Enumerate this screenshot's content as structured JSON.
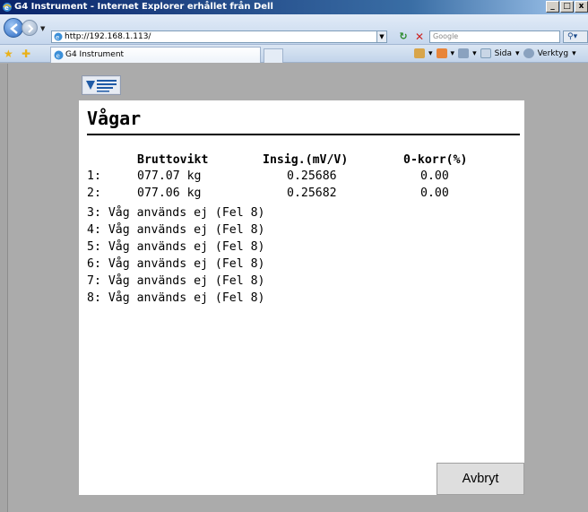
{
  "window": {
    "title": "G4 Instrument - Internet Explorer erhållet från Dell",
    "buttons": [
      "_",
      "□",
      "x"
    ]
  },
  "address": {
    "url": "http://192.168.1.113/",
    "search_placeholder": "Google"
  },
  "tabs": {
    "active_label": "G4 Instrument"
  },
  "commands": {
    "page_label": "Sida",
    "tools_label": "Verktyg"
  },
  "panel": {
    "title": "Vågar",
    "headers": {
      "gross": "Bruttovikt",
      "signal": "Insig.(mV/V)",
      "zero": "0-korr(%)"
    },
    "active_rows": [
      {
        "num": "1:",
        "gross": "077.07 kg",
        "signal": "0.25686",
        "zero": "0.00"
      },
      {
        "num": "2:",
        "gross": "077.06 kg",
        "signal": "0.25682",
        "zero": "0.00"
      }
    ],
    "inactive_rows": [
      "3: Våg används ej (Fel 8)",
      "4: Våg används ej (Fel 8)",
      "5: Våg används ej (Fel 8)",
      "6: Våg används ej (Fel 8)",
      "7: Våg används ej (Fel 8)",
      "8: Våg används ej (Fel 8)"
    ],
    "cancel_label": "Avbryt"
  },
  "colors": {
    "titlebar": "#0a246a",
    "content_bg": "#ababab",
    "panel_bg": "#ffffff",
    "button_bg": "#dedede"
  }
}
